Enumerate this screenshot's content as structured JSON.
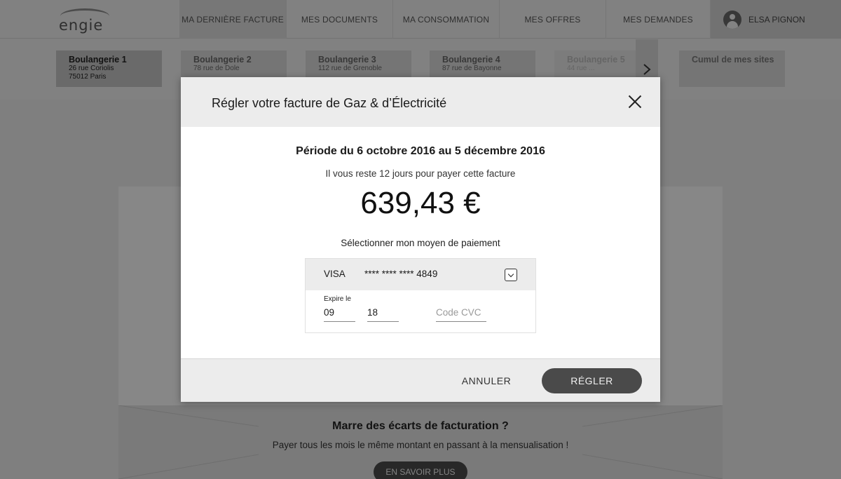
{
  "header": {
    "logo_text": "engie",
    "nav": [
      {
        "label": "MA DERNIÈRE FACTURE",
        "active": true
      },
      {
        "label": "MES DOCUMENTS",
        "active": false
      },
      {
        "label": "MA CONSOMMATION",
        "active": false
      },
      {
        "label": "MES OFFRES",
        "active": false
      },
      {
        "label": "MES DEMANDES",
        "active": false
      }
    ],
    "user_name": "ELSA PIGNON"
  },
  "sites": [
    {
      "name": "Boulangerie 1",
      "address": "26 rue Coriolis",
      "city": "75012 Paris"
    },
    {
      "name": "Boulangerie 2",
      "address": "78 rue de Dole",
      "city": ""
    },
    {
      "name": "Boulangerie 3",
      "address": "112 rue de Grenoble",
      "city": ""
    },
    {
      "name": "Boulangerie 4",
      "address": "87 rue de Bayonne",
      "city": ""
    },
    {
      "name": "Boulangerie 5",
      "address": "44 rue ...",
      "city": ""
    }
  ],
  "sites_next_icon": "chevron-right-icon",
  "cumul_label": "Cumul de mes sites",
  "promo": {
    "title": "Marre des écarts de facturation ?",
    "subtitle": "Payer tous les mois le même montant en passant à la mensualisation !",
    "button": "EN SAVOIR PLUS"
  },
  "modal": {
    "title": "Régler votre facture de Gaz & d’Électricité",
    "period": "Période du 6 octobre 2016 au 5 décembre 2016",
    "remaining": "Il vous reste 12 jours pour payer cette facture",
    "amount": "639,43 €",
    "select_label": "Sélectionner mon moyen de paiement",
    "card": {
      "brand": "VISA",
      "number": "**** **** **** 4849",
      "expire_label": "Expire le",
      "month": "09",
      "year": "18",
      "cvc_placeholder": "Code CVC"
    },
    "cancel_label": "ANNULER",
    "pay_label": "RÉGLER"
  },
  "colors": {
    "primary_button": "#4a4a4a",
    "overlay": "rgba(0,0,0,0.45)",
    "header_bg": "#ececec"
  }
}
